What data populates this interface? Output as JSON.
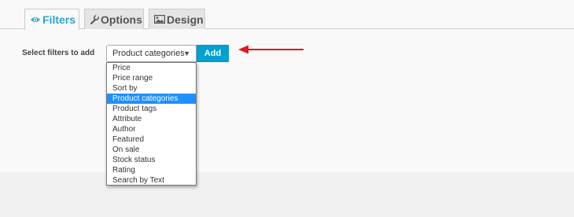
{
  "tabs": [
    {
      "label": "Filters",
      "icon": "eye-icon",
      "active": true
    },
    {
      "label": "Options",
      "icon": "wrench-icon",
      "active": false
    },
    {
      "label": "Design",
      "icon": "image-icon",
      "active": false
    }
  ],
  "filter_form": {
    "label": "Select filters to add",
    "selected_value": "Product categories",
    "add_label": "Add",
    "caret": "▼",
    "options": [
      "Price",
      "Price range",
      "Sort by",
      "Product categories",
      "Product tags",
      "Attribute",
      "Author",
      "Featured",
      "On sale",
      "Stock status",
      "Rating",
      "Search by Text"
    ],
    "highlighted_index": 3
  },
  "colors": {
    "accent": "#2ea2cc",
    "button": "#00a0d2",
    "highlight": "#1e90ff",
    "annotation_arrow": "#e0191b"
  }
}
